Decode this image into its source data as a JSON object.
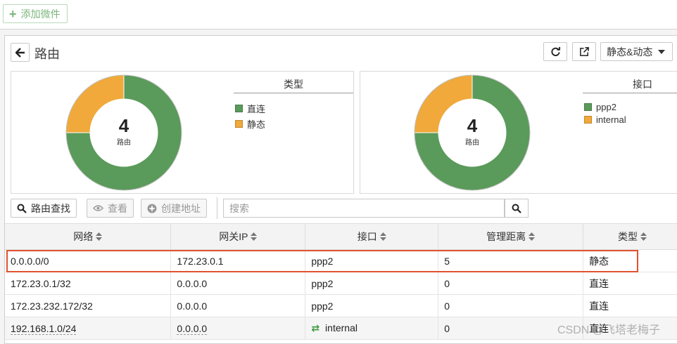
{
  "topbar": {
    "add_widget_label": "添加微件"
  },
  "widget": {
    "title": "路由",
    "filter_dropdown": "静态&动态"
  },
  "colors": {
    "green": "#5a9a5a",
    "orange": "#f0a93a",
    "highlight": "#e0522f"
  },
  "chart_data": [
    {
      "type": "pie",
      "title": "类型",
      "center_value": "4",
      "center_label": "路由",
      "labels": [
        "直连",
        "静态"
      ],
      "values": [
        3,
        1
      ],
      "colors": [
        "#5a9a5a",
        "#f0a93a"
      ]
    },
    {
      "type": "pie",
      "title": "接口",
      "center_value": "4",
      "center_label": "路由",
      "labels": [
        "ppp2",
        "internal"
      ],
      "values": [
        3,
        1
      ],
      "colors": [
        "#5a9a5a",
        "#f0a93a"
      ]
    }
  ],
  "actions": {
    "lookup": "路由查找",
    "view": "查看",
    "create_address": "创建地址",
    "search_placeholder": "搜索"
  },
  "table": {
    "headers": [
      "网络",
      "网关IP",
      "接口",
      "管理距离",
      "类型"
    ],
    "rows": [
      [
        "0.0.0.0/0",
        "172.23.0.1",
        "ppp2",
        "5",
        "静态"
      ],
      [
        "172.23.0.1/32",
        "0.0.0.0",
        "ppp2",
        "0",
        "直连"
      ],
      [
        "172.23.232.172/32",
        "0.0.0.0",
        "ppp2",
        "0",
        "直连"
      ],
      [
        "192.168.1.0/24",
        "0.0.0.0",
        "internal",
        "0",
        "直连"
      ]
    ]
  },
  "watermark": "CSDN @飞塔老梅子"
}
